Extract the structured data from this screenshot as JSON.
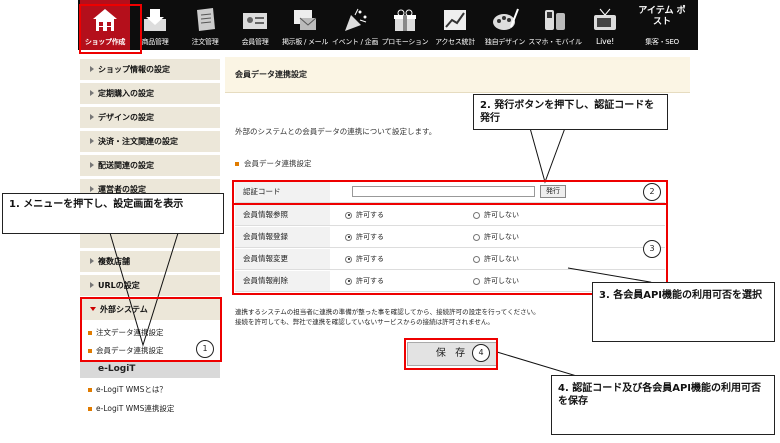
{
  "nav": {
    "items": [
      {
        "label": "ショップ作成",
        "icon": "house-icon"
      },
      {
        "label": "商品管理",
        "icon": "inbox-icon"
      },
      {
        "label": "注文管理",
        "icon": "order-sheet-icon"
      },
      {
        "label": "会員管理",
        "icon": "member-card-icon"
      },
      {
        "label": "掲示板 / メール",
        "icon": "board-mail-icon"
      },
      {
        "label": "イベント / 企画",
        "icon": "party-popper-icon"
      },
      {
        "label": "プロモーション",
        "icon": "gift-icon"
      },
      {
        "label": "アクセス統計",
        "icon": "chart-icon"
      },
      {
        "label": "独自デザイン",
        "icon": "palette-icon"
      },
      {
        "label": "スマホ・モバイル",
        "icon": "mobile-phone-icon"
      },
      {
        "label": "Live!",
        "icon": "tv-icon"
      },
      {
        "label": "集客・SEO",
        "icon": "item-post-logo",
        "logo_text": "アイテム ポスト"
      }
    ]
  },
  "sidebar": {
    "items": [
      "ショップ情報の設定",
      "定期購入の設定",
      "デザインの設定",
      "決済・注文関連の設定",
      "配送関連の設定",
      "運営者の設定",
      "複数店舗",
      "URLの設定",
      "外部システム"
    ],
    "subitems": [
      "注文データ連携設定",
      "会員データ連携設定"
    ],
    "elogit_header": "e-LogiT",
    "elogit_items": [
      "e-LogiT WMSとは？",
      "e-LogiT WMS連携設定"
    ]
  },
  "main": {
    "page_title": "会員データ連携設定",
    "description": "外部のシステムとの会員データの連携について設定します。",
    "section_title": "会員データ連携設定",
    "auth_code_label": "認証コード",
    "issue_button": "発行",
    "rows": [
      {
        "label": "会員情報参照",
        "allow": "許可する",
        "deny": "許可しない"
      },
      {
        "label": "会員情報登録",
        "allow": "許可する",
        "deny": "許可しない"
      },
      {
        "label": "会員情報変更",
        "allow": "許可する",
        "deny": "許可しない"
      },
      {
        "label": "会員情報削除",
        "allow": "許可する",
        "deny": "許可しない"
      }
    ],
    "note_line1": "連携するシステムの担当者に連携の準備が整った事を確認してから、接続許可の設定を行ってください。",
    "note_line2": "接続を許可しても、弊社で連携を確認していないサービスからの接続は許可されません。",
    "save_button": "保 存"
  },
  "annotations": {
    "callout1": "1.  メニューを押下し、設定画面を表示",
    "callout2": "2.  発行ボタンを押下し、認証コードを発行",
    "callout3": "3.  各会員API機能の利用可否を選択",
    "callout4": "4.  認証コード及び各会員API機能の利用可否を保存",
    "num1": "1",
    "num2": "2",
    "num3": "3",
    "num4": "4"
  },
  "colors": {
    "highlight": "#e00000",
    "nav_bg": "#0d0d0d",
    "nav_active": "#b40f1b",
    "sidebar_bg": "#ece7d9"
  }
}
